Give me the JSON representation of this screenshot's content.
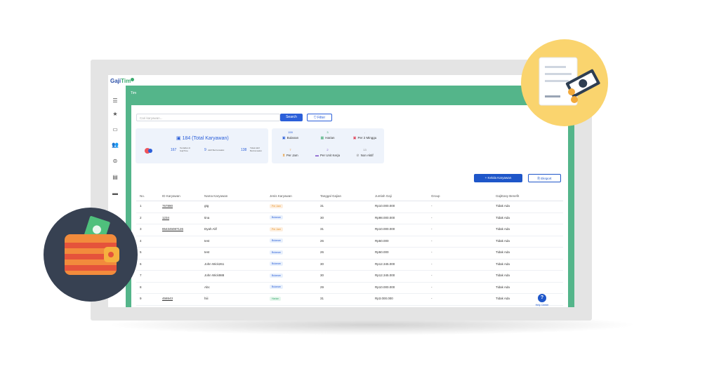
{
  "app": {
    "logo_main": "Gaji",
    "logo_accent": "Tim",
    "page_title": "Tim"
  },
  "search": {
    "placeholder": "Cari karyawan...",
    "button": "Search",
    "filter": "Filter"
  },
  "summary": {
    "total": "184 (Total Karyawan)",
    "stats": [
      {
        "value": "167",
        "label": "Terdaftar di GajiTime"
      },
      {
        "value": "9",
        "label": "Aktif Bertransaksi"
      },
      {
        "value": "138",
        "label": "Tidak Aktif Bertransaksi"
      }
    ]
  },
  "pay_types": [
    {
      "count": "159",
      "label": "Bulanan",
      "icon": "calendar-icon"
    },
    {
      "count": "3",
      "label": "Harian",
      "icon": "day-icon"
    },
    {
      "count": "-",
      "label": "Per 2 Minggu",
      "icon": "biweek-icon"
    },
    {
      "count": "7",
      "label": "Per Jam",
      "icon": "hourglass-icon"
    },
    {
      "count": "2",
      "label": "Per Unit Kerja",
      "icon": "unit-icon"
    },
    {
      "count": "13",
      "label": "Non Aktif",
      "icon": "inactive-icon"
    }
  ],
  "actions": {
    "add": "Kelola Karyawan",
    "export": "Eksport"
  },
  "table": {
    "headers": [
      "No.",
      "ID Karyawan",
      "Nama Karyawan",
      "Jenis Karyawan",
      "Tanggal Gajian",
      "Jumlah Gaji",
      "Group",
      "GajiEasy Benefit"
    ],
    "rows": [
      {
        "no": "1",
        "id": "767890",
        "name": "gtg",
        "type": "Per Jam",
        "date": "31",
        "amount": "Rp10.000.000",
        "group": "-",
        "benefit": "Tidak Ada"
      },
      {
        "no": "2",
        "id": "1234",
        "name": "tina",
        "type": "Bulanan",
        "date": "30",
        "amount": "Rp98.000.000",
        "group": "-",
        "benefit": "Tidak Ada"
      },
      {
        "no": "3",
        "id": "854345087126",
        "name": "Dyah Alif",
        "type": "Per Jam",
        "date": "31",
        "amount": "Rp10.000.000",
        "group": "-",
        "benefit": "Tidak Ada"
      },
      {
        "no": "4",
        "id": "",
        "name": "test",
        "type": "Bulanan",
        "date": "26",
        "amount": "Rp50.000",
        "group": "-",
        "benefit": "Tidak Ada"
      },
      {
        "no": "5",
        "id": "",
        "name": "test",
        "type": "Bulanan",
        "date": "26",
        "amount": "Rp50.000",
        "group": "-",
        "benefit": "Tidak Ada"
      },
      {
        "no": "6",
        "id": "",
        "name": "John Wick261",
        "type": "Bulanan",
        "date": "30",
        "amount": "Rp12.345.000",
        "group": "-",
        "benefit": "Tidak Ada"
      },
      {
        "no": "7",
        "id": "",
        "name": "John Wick988",
        "type": "Bulanan",
        "date": "30",
        "amount": "Rp12.345.000",
        "group": "-",
        "benefit": "Tidak Ada"
      },
      {
        "no": "8",
        "id": "",
        "name": "Abc",
        "type": "Bulanan",
        "date": "29",
        "amount": "Rp10.000.000",
        "group": "-",
        "benefit": "Tidak Ada"
      },
      {
        "no": "9",
        "id": "456543",
        "name": "hiii",
        "type": "Harian",
        "date": "31",
        "amount": "Rp3.000.000",
        "group": "-",
        "benefit": "Tidak Ada"
      },
      {
        "no": "10",
        "id": "DUMMY0011",
        "name": "dompet merah",
        "type": "Bulanan",
        "date": "26",
        "amount": "Rp1.000.000",
        "group": "-",
        "benefit": "Tidak Ada"
      }
    ]
  },
  "help": {
    "label": "Help Center",
    "icon": "question-icon"
  },
  "colors": {
    "primary": "#1e56c9",
    "teal": "#54b58a",
    "yellow": "#fad46e",
    "dark": "#374152"
  }
}
